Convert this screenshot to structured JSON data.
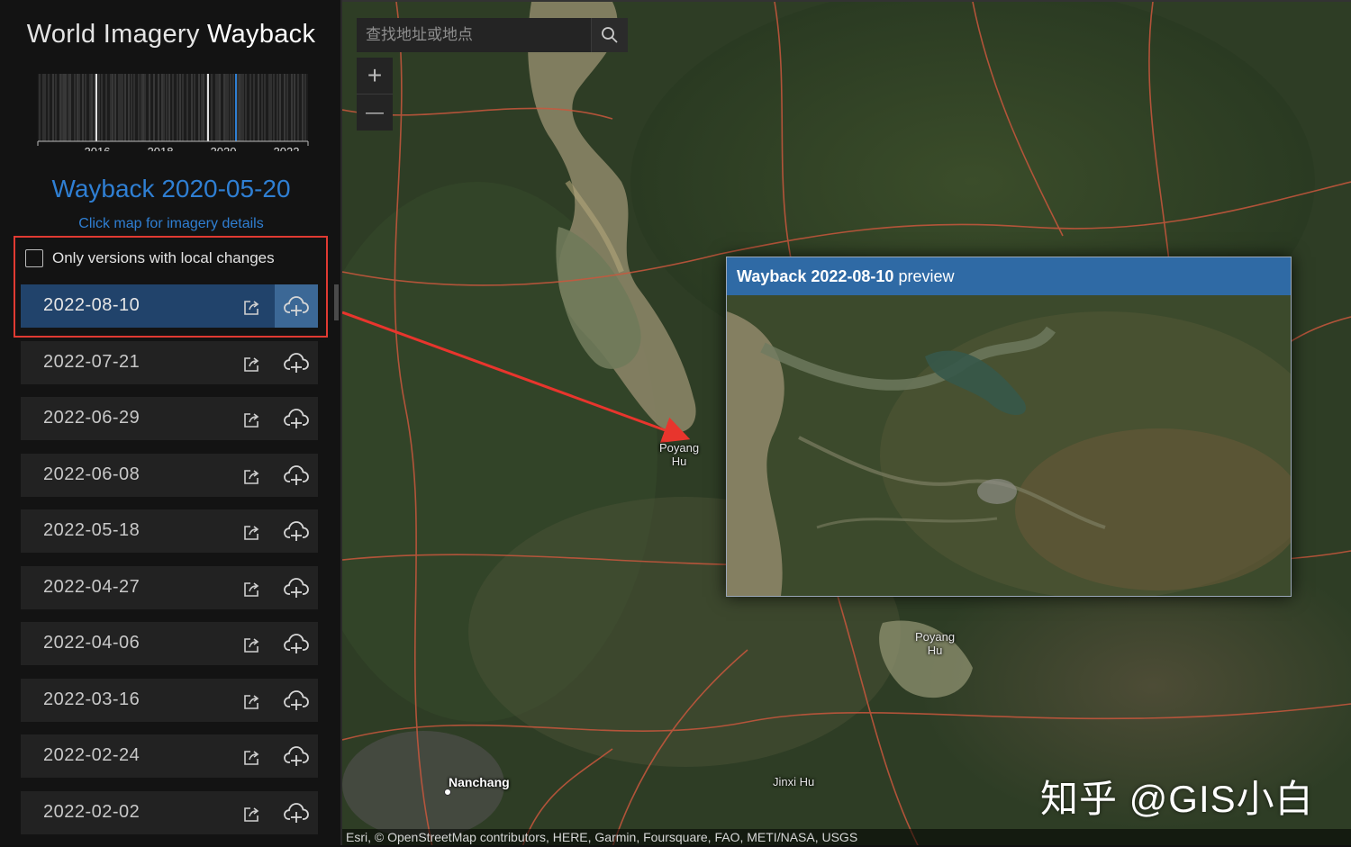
{
  "app": {
    "title_light": "World Imagery",
    "title_bold": "Wayback",
    "selected_version": "Wayback 2020-05-20",
    "click_hint": "Click map for imagery details",
    "filter_label": "Only versions with local changes"
  },
  "timeline": {
    "years": [
      "2016",
      "2018",
      "2020",
      "2022"
    ]
  },
  "releases": [
    {
      "date": "2022-08-10",
      "active": true
    },
    {
      "date": "2022-07-21",
      "active": false
    },
    {
      "date": "2022-06-29",
      "active": false
    },
    {
      "date": "2022-06-08",
      "active": false
    },
    {
      "date": "2022-05-18",
      "active": false
    },
    {
      "date": "2022-04-27",
      "active": false
    },
    {
      "date": "2022-04-06",
      "active": false
    },
    {
      "date": "2022-03-16",
      "active": false
    },
    {
      "date": "2022-02-24",
      "active": false
    },
    {
      "date": "2022-02-02",
      "active": false
    }
  ],
  "map": {
    "search_placeholder": "查找地址或地点",
    "zoom_in": "+",
    "zoom_out": "—",
    "labels": {
      "poyang_upper": "Poyang\nHu",
      "poyang_lower": "Poyang\nHu",
      "nanchang": "Nanchang",
      "jinxi": "Jinxi Hu"
    },
    "attribution": "Esri, © OpenStreetMap contributors, HERE, Garmin, Foursquare, FAO, METI/NASA, USGS",
    "watermark": "知乎 @GIS小白"
  },
  "preview": {
    "title_bold": "Wayback 2022-08-10",
    "title_rest": " preview"
  },
  "colors": {
    "accent_blue": "#2f7fd3",
    "active_row": "#21436b",
    "preview_header": "#2f6aa5",
    "highlight_red": "#e03a32",
    "road_red": "#d0583e"
  }
}
